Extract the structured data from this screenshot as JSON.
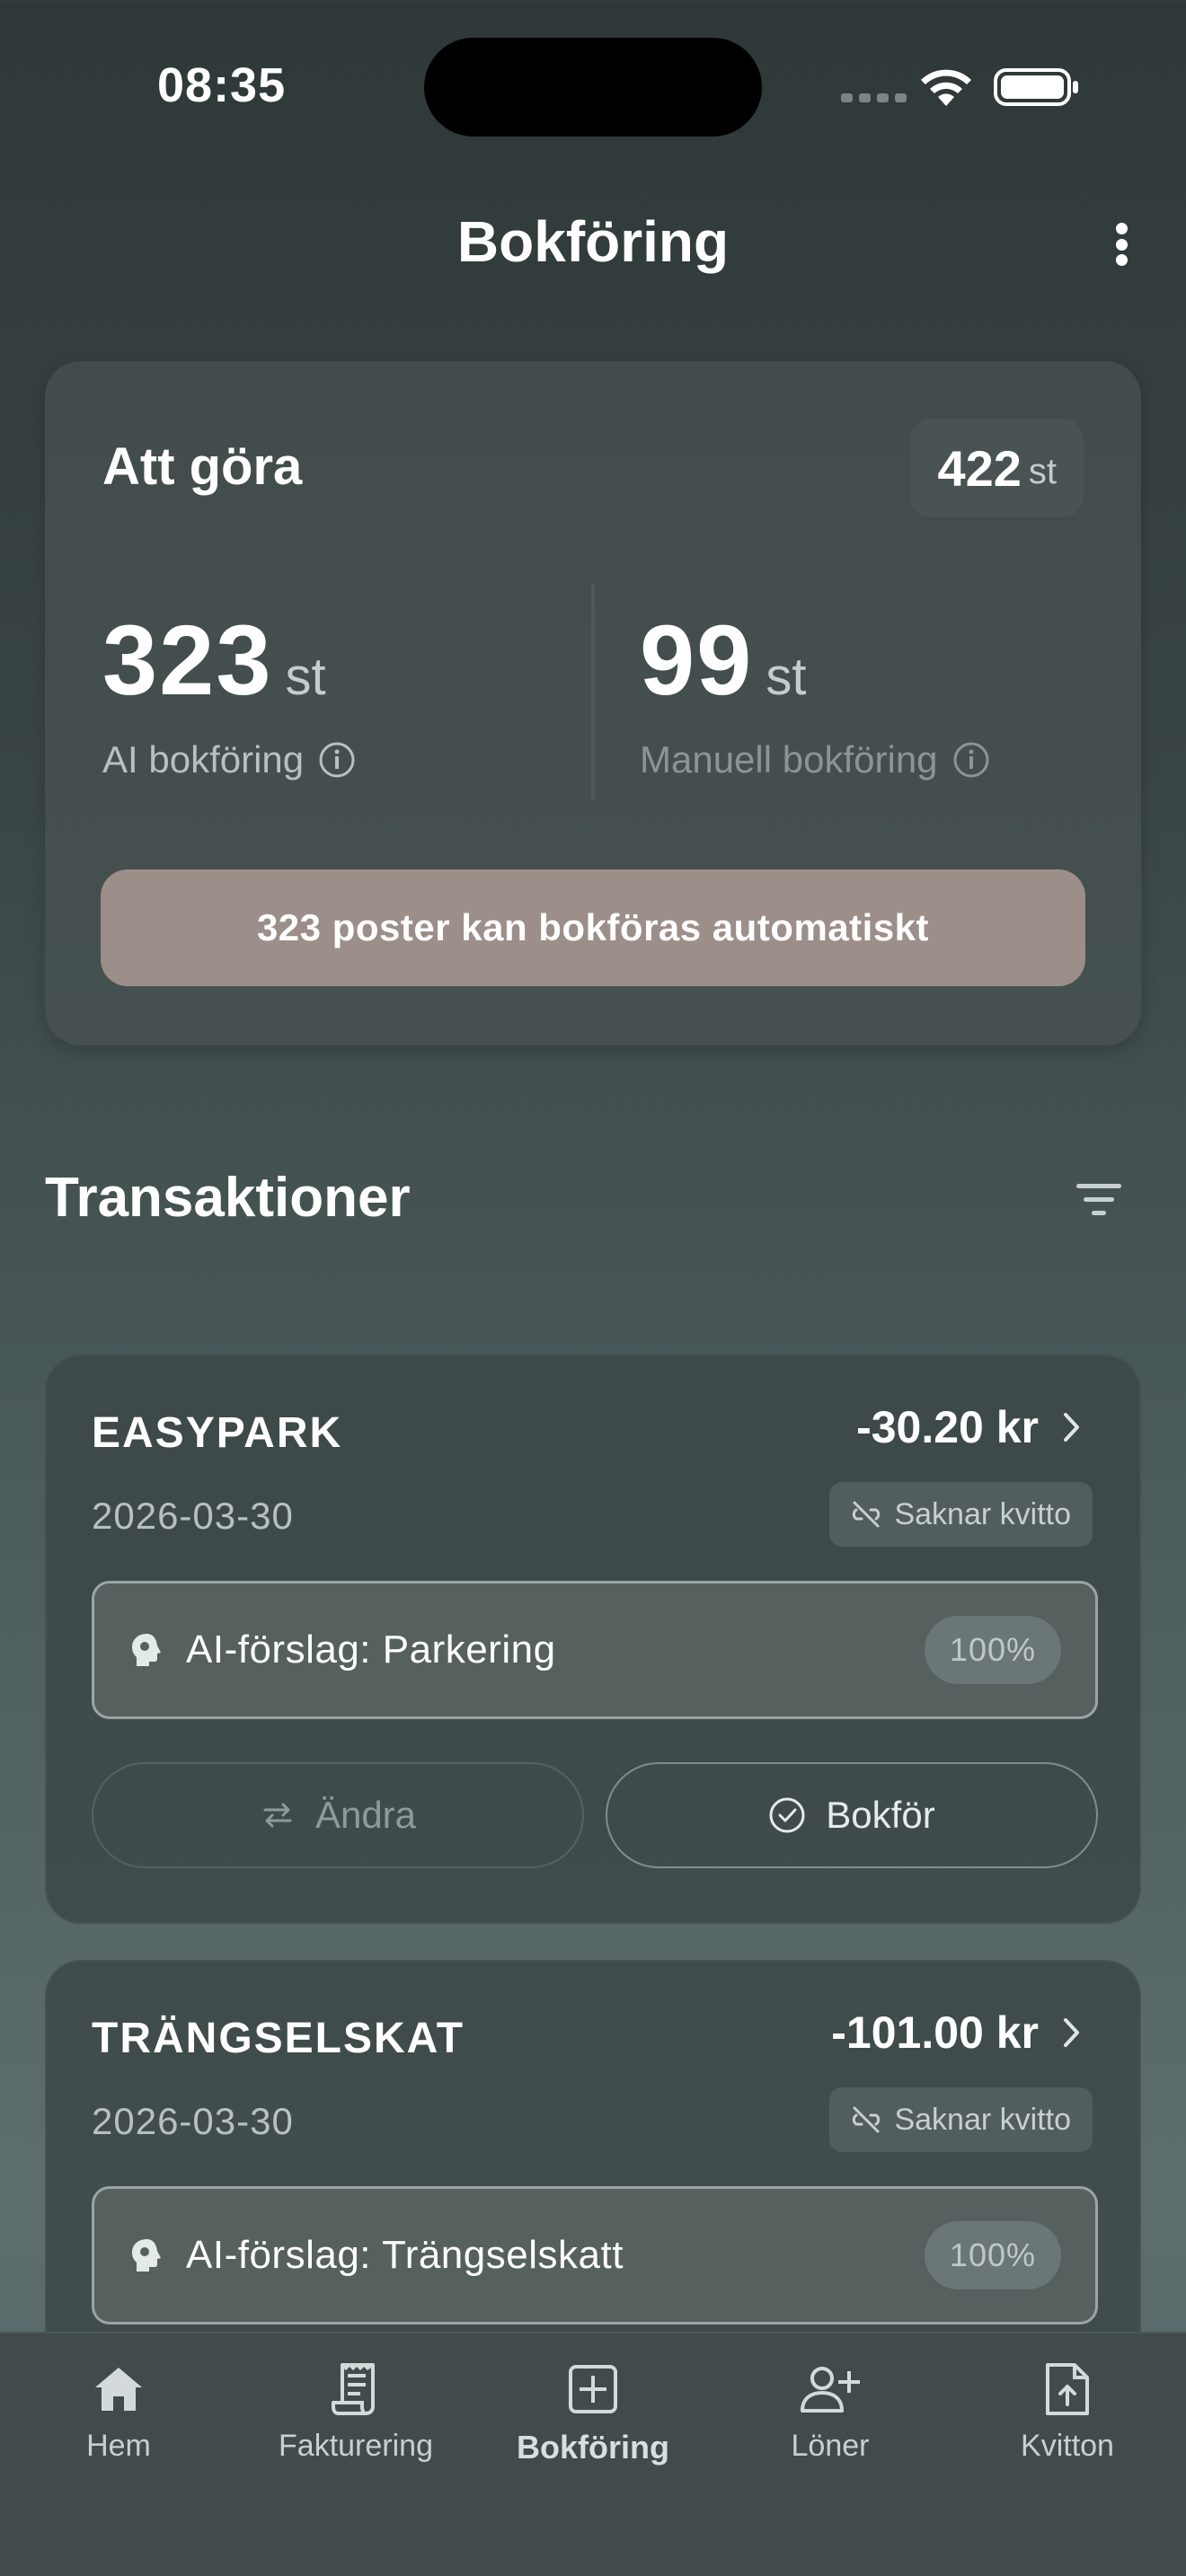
{
  "status_bar": {
    "time": "08:35"
  },
  "header": {
    "title": "Bokföring"
  },
  "summary": {
    "title": "Att göra",
    "total_count": "422",
    "total_unit": "st",
    "ai_count": "323",
    "ai_unit": "st",
    "ai_label": "AI bokföring",
    "manual_count": "99",
    "manual_unit": "st",
    "manual_label": "Manuell bokföring",
    "auto_button": "323 poster kan bokföras automatiskt"
  },
  "transactions_section": {
    "title": "Transaktioner"
  },
  "transactions": [
    {
      "name": "EASYPARK",
      "amount": "-30.20 kr",
      "date": "2026-03-30",
      "receipt_status": "Saknar kvitto",
      "ai_suggestion": "AI-förslag: Parkering",
      "confidence": "100%",
      "change_label": "Ändra",
      "book_label": "Bokför"
    },
    {
      "name": "TRÄNGSELSKAT",
      "amount": "-101.00 kr",
      "date": "2026-03-30",
      "receipt_status": "Saknar kvitto",
      "ai_suggestion": "AI-förslag: Trängselskatt",
      "confidence": "100%"
    }
  ],
  "bottom_nav": {
    "items": [
      {
        "label": "Hem",
        "icon": "home-icon"
      },
      {
        "label": "Fakturering",
        "icon": "invoice-icon"
      },
      {
        "label": "Bokföring",
        "icon": "plus-square-icon",
        "active": true
      },
      {
        "label": "Löner",
        "icon": "person-add-icon"
      },
      {
        "label": "Kvitton",
        "icon": "file-upload-icon"
      }
    ]
  },
  "colors": {
    "background": "#3a4545",
    "card": "#485252",
    "accent_button": "#9c8e89",
    "text_primary": "#ffffff",
    "text_muted": "#b8c0c0"
  }
}
